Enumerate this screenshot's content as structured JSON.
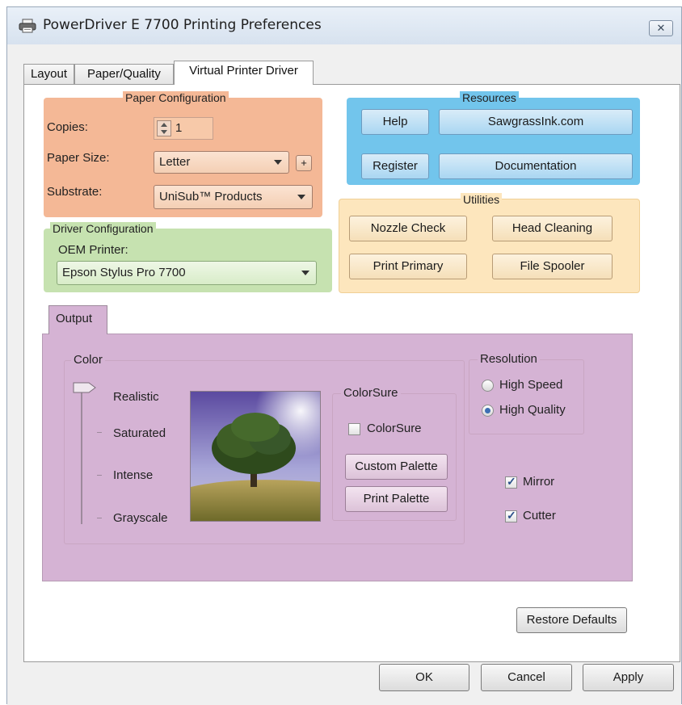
{
  "window": {
    "title": "PowerDriver E 7700 Printing Preferences",
    "close_icon": "close-icon"
  },
  "tabs": [
    {
      "label": "Layout",
      "active": false
    },
    {
      "label": "Paper/Quality",
      "active": false
    },
    {
      "label": "Virtual Printer Driver",
      "active": true
    }
  ],
  "paper_config": {
    "title": "Paper Configuration",
    "copies_label": "Copies:",
    "copies_value": "1",
    "paper_size_label": "Paper Size:",
    "paper_size_value": "Letter",
    "add_button": "+",
    "substrate_label": "Substrate:",
    "substrate_value": "UniSub™ Products",
    "color": "#f4b896"
  },
  "driver_config": {
    "title": "Driver Configuration",
    "oem_label": "OEM Printer:",
    "oem_value": "Epson Stylus Pro 7700",
    "color": "#c6e2b0"
  },
  "resources": {
    "title": "Resources",
    "help": "Help",
    "sawgrass": "SawgrassInk.com",
    "register": "Register",
    "documentation": "Documentation",
    "color": "#72c5ec"
  },
  "utilities": {
    "title": "Utilities",
    "nozzle_check": "Nozzle Check",
    "head_cleaning": "Head Cleaning",
    "print_primary": "Print Primary",
    "file_spooler": "File Spooler",
    "color": "#fde6bd"
  },
  "output": {
    "tab_label": "Output",
    "color": "#d5b3d4",
    "color_group": {
      "title": "Color",
      "levels": [
        "Realistic",
        "Saturated",
        "Intense",
        "Grayscale"
      ],
      "selected": "Realistic"
    },
    "colorsure": {
      "title": "ColorSure",
      "checkbox_label": "ColorSure",
      "checked": false,
      "custom_palette": "Custom Palette",
      "print_palette": "Print Palette"
    },
    "resolution": {
      "title": "Resolution",
      "options": [
        "High Speed",
        "High Quality"
      ],
      "selected": "High Quality"
    },
    "mirror": {
      "label": "Mirror",
      "checked": true
    },
    "cutter": {
      "label": "Cutter",
      "checked": true
    }
  },
  "restore_defaults": "Restore Defaults",
  "footer": {
    "ok": "OK",
    "cancel": "Cancel",
    "apply": "Apply"
  }
}
